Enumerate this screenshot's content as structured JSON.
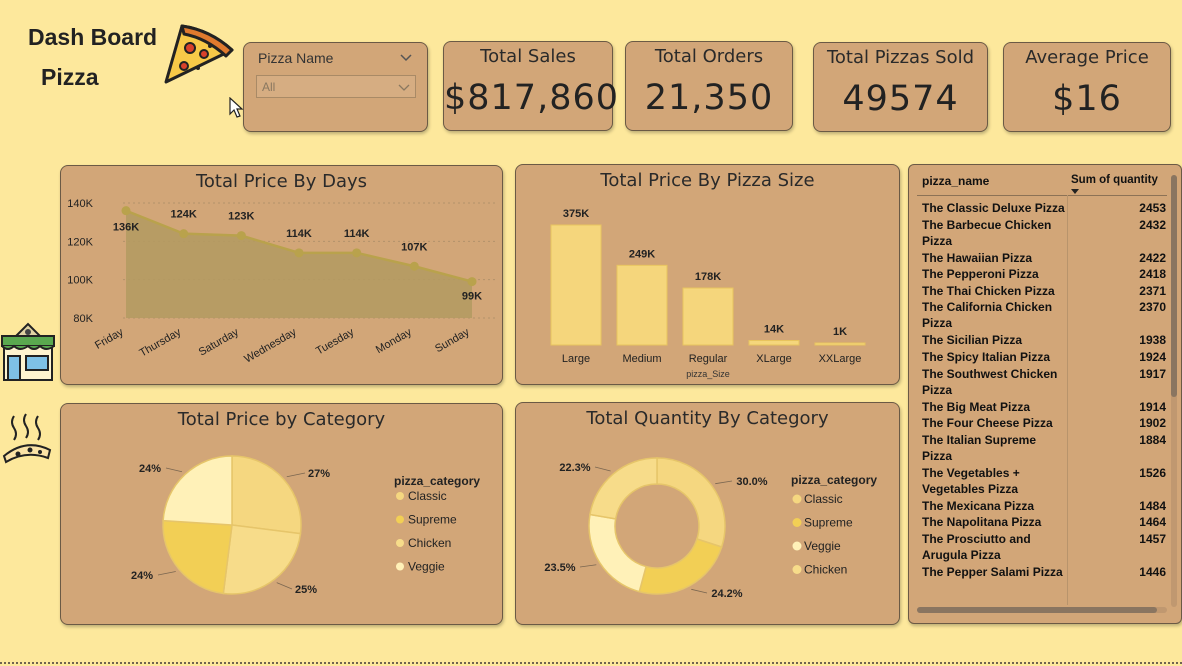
{
  "header": {
    "title_line1": "Dash Board",
    "title_line2": "Pizza"
  },
  "slicer": {
    "label": "Pizza Name",
    "value": "All"
  },
  "kpis": [
    {
      "label": "Total Sales",
      "value": "$817,860"
    },
    {
      "label": "Total Orders",
      "value": "21,350"
    },
    {
      "label": "Total Pizzas Sold",
      "value": "49574"
    },
    {
      "label": "Average Price",
      "value": "$16"
    }
  ],
  "colors": {
    "background": "#fde89c",
    "card": "#d2a678",
    "area_fill": "#b39a60",
    "line": "#b9a24c",
    "bar": "#f5d67c",
    "classic": "#f5d780",
    "supreme": "#f2cf55",
    "chicken": "#f7dc8a",
    "veggie": "#fff1b8"
  },
  "icons": [
    "pizza-slice-icon",
    "shop-icon",
    "hot-pizza-icon",
    "cursor-icon",
    "chevron-down-icon"
  ],
  "chart_data": [
    {
      "type": "area",
      "title": "Total Price By Days",
      "categories": [
        "Friday",
        "Thursday",
        "Saturday",
        "Wednesday",
        "Tuesday",
        "Monday",
        "Sunday"
      ],
      "values": [
        136,
        124,
        123,
        114,
        114,
        107,
        99
      ],
      "data_labels": [
        "136K",
        "124K",
        "123K",
        "114K",
        "114K",
        "107K",
        "99K"
      ],
      "yticks": [
        "80K",
        "100K",
        "120K",
        "140K"
      ],
      "ylim": [
        80,
        140
      ],
      "grid": true
    },
    {
      "type": "bar",
      "title": "Total Price By Pizza Size",
      "xlabel": "pizza_Size",
      "categories": [
        "Large",
        "Medium",
        "Regular",
        "XLarge",
        "XXLarge"
      ],
      "values": [
        375,
        249,
        178,
        14,
        1
      ],
      "data_labels": [
        "375K",
        "249K",
        "178K",
        "14K",
        "1K"
      ]
    },
    {
      "type": "pie",
      "title": "Total Price by Category",
      "legend_title": "pizza_category",
      "legend": [
        "Classic",
        "Supreme",
        "Chicken",
        "Veggie"
      ],
      "values": [
        27,
        25,
        24,
        24
      ],
      "data_labels": [
        "27%",
        "25%",
        "24%",
        "24%"
      ]
    },
    {
      "type": "pie",
      "title": "Total Quantity By Category",
      "legend_title": "pizza_category",
      "legend": [
        "Classic",
        "Supreme",
        "Veggie",
        "Chicken"
      ],
      "values": [
        30.0,
        24.2,
        23.5,
        22.3
      ],
      "data_labels": [
        "30.0%",
        "24.2%",
        "23.5%",
        "22.3%"
      ]
    },
    {
      "type": "table",
      "columns": [
        "pizza_name",
        "Sum of quantity"
      ],
      "rows": [
        [
          "The Classic Deluxe Pizza",
          "2453"
        ],
        [
          "The Barbecue Chicken Pizza",
          "2432"
        ],
        [
          "The Hawaiian Pizza",
          "2422"
        ],
        [
          "The Pepperoni Pizza",
          "2418"
        ],
        [
          "The Thai Chicken Pizza",
          "2371"
        ],
        [
          "The California Chicken Pizza",
          "2370"
        ],
        [
          "The Sicilian Pizza",
          "1938"
        ],
        [
          "The Spicy Italian Pizza",
          "1924"
        ],
        [
          "The Southwest Chicken Pizza",
          "1917"
        ],
        [
          "The Big Meat Pizza",
          "1914"
        ],
        [
          "The Four Cheese Pizza",
          "1902"
        ],
        [
          "The Italian Supreme Pizza",
          "1884"
        ],
        [
          "The Vegetables + Vegetables Pizza",
          "1526"
        ],
        [
          "The Mexicana Pizza",
          "1484"
        ],
        [
          "The Napolitana Pizza",
          "1464"
        ],
        [
          "The Prosciutto and Arugula Pizza",
          "1457"
        ],
        [
          "The Pepper Salami Pizza",
          "1446"
        ]
      ]
    }
  ]
}
